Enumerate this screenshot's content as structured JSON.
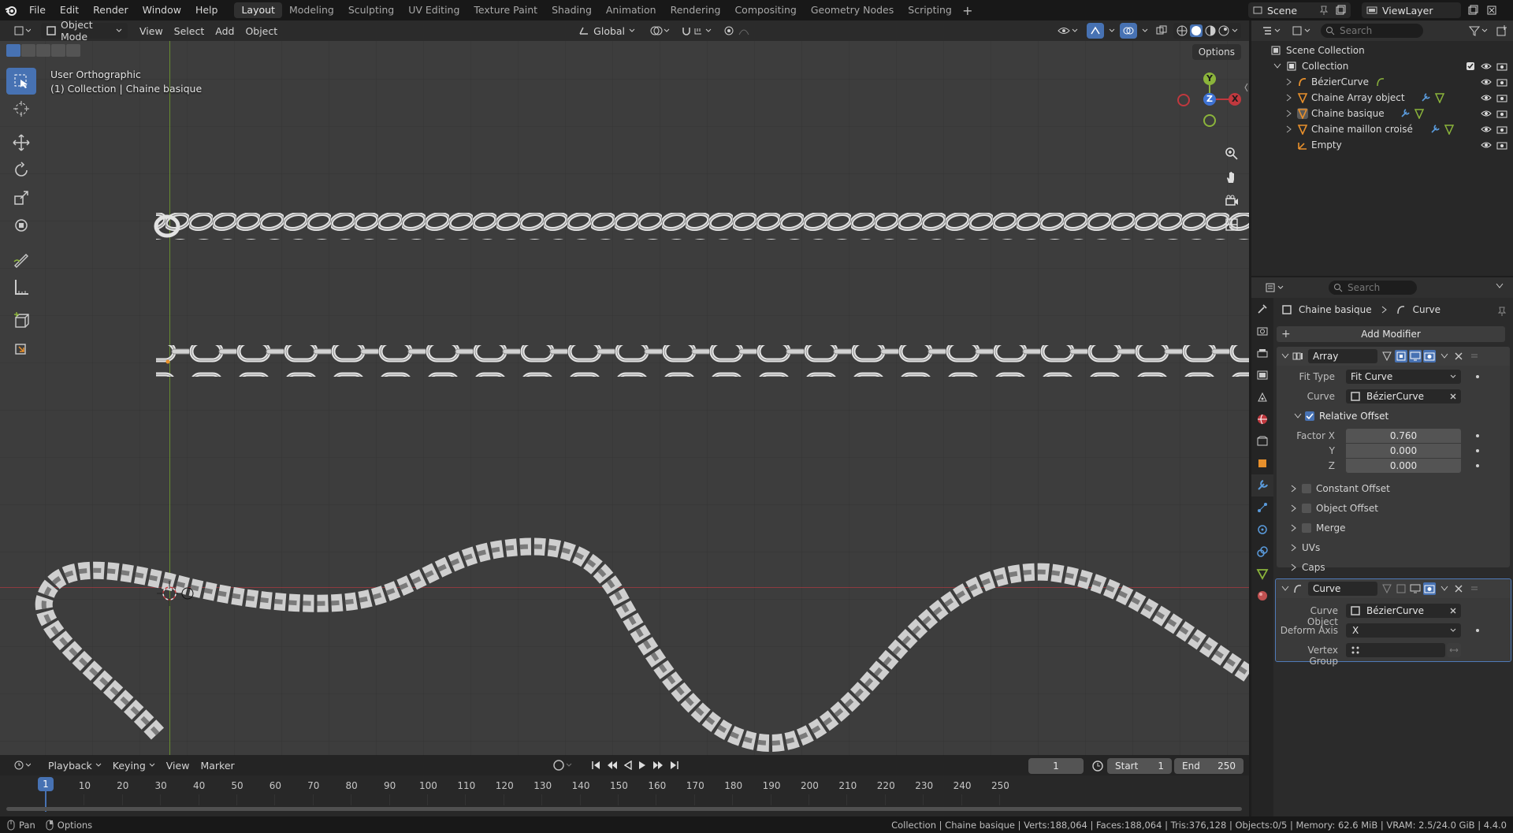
{
  "topbar": {
    "menus": [
      "File",
      "Edit",
      "Render",
      "Window",
      "Help"
    ],
    "workspaces": [
      "Layout",
      "Modeling",
      "Sculpting",
      "UV Editing",
      "Texture Paint",
      "Shading",
      "Animation",
      "Rendering",
      "Compositing",
      "Geometry Nodes",
      "Scripting"
    ],
    "active_workspace": "Layout",
    "scene": "Scene",
    "view_layer": "ViewLayer"
  },
  "viewport": {
    "mode": "Object Mode",
    "menus": [
      "View",
      "Select",
      "Add",
      "Object"
    ],
    "orientation": "Global",
    "options_label": "Options",
    "view_name": "User Orthographic",
    "collection_info": "(1) Collection | Chaine basique",
    "gizmo": {
      "y": "Y",
      "z": "Z",
      "x": "X"
    }
  },
  "timeline": {
    "menus": [
      "Playback",
      "Keying",
      "View",
      "Marker"
    ],
    "current_frame": "1",
    "start_label": "Start",
    "start": "1",
    "end_label": "End",
    "end": "250",
    "ruler": [
      "10",
      "20",
      "30",
      "40",
      "50",
      "60",
      "70",
      "80",
      "90",
      "100",
      "110",
      "120",
      "130",
      "140",
      "150",
      "160",
      "170",
      "180",
      "190",
      "200",
      "210",
      "220",
      "230",
      "240",
      "250"
    ],
    "playhead": "1"
  },
  "statusbar": {
    "left_items": [
      "Pan",
      "Options"
    ],
    "info": "Collection | Chaine basique | Verts:188,064 | Faces:188,064 | Tris:376,128 | Objects:0/5 | Memory: 62.6 MiB | VRAM: 2.5/24.0 GiB | 4.4.0"
  },
  "outliner": {
    "search_placeholder": "Search",
    "root": "Scene Collection",
    "collection": "Collection",
    "items": [
      {
        "name": "BézierCurve",
        "type": "curve"
      },
      {
        "name": "Chaine Array object",
        "type": "mesh"
      },
      {
        "name": "Chaine basique",
        "type": "mesh"
      },
      {
        "name": "Chaine maillon croisé",
        "type": "mesh"
      },
      {
        "name": "Empty",
        "type": "empty"
      }
    ]
  },
  "properties": {
    "search_placeholder": "Search",
    "breadcrumb_object": "Chaine basique",
    "breadcrumb_modifier": "Curve",
    "add_modifier": "Add Modifier",
    "array": {
      "name": "Array",
      "fit_type_label": "Fit Type",
      "fit_type": "Fit Curve",
      "curve_label": "Curve",
      "curve": "BézierCurve",
      "relative_offset": "Relative Offset",
      "factor_x_label": "Factor X",
      "factor_x": "0.760",
      "y_label": "Y",
      "y": "0.000",
      "z_label": "Z",
      "z": "0.000",
      "subpanels": [
        "Constant Offset",
        "Object Offset",
        "Merge",
        "UVs",
        "Caps"
      ]
    },
    "curve_mod": {
      "name": "Curve",
      "curve_object_label": "Curve Object",
      "curve_object": "BézierCurve",
      "deform_axis_label": "Deform Axis",
      "deform_axis": "X",
      "vertex_group_label": "Vertex Group",
      "vertex_group": ""
    }
  },
  "colors": {
    "accent": "#4772b3",
    "viewport_bg": "#3d3d3d",
    "x_axis": "#c0383e",
    "y_axis": "#8bb43b",
    "mesh_orange": "#e8902c"
  }
}
